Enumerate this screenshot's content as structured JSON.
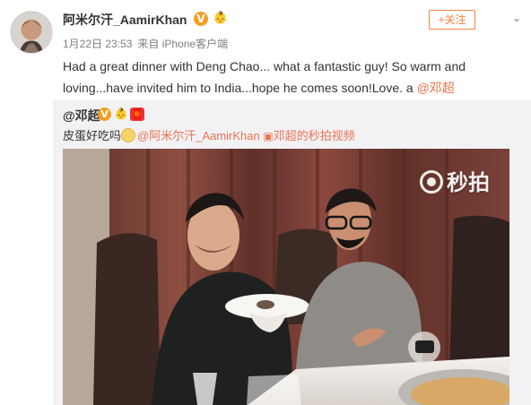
{
  "post": {
    "username": "阿米尔汗_AamirKhan",
    "verified_icon": "V",
    "level_icon": "👶",
    "follow_label": "+关注",
    "menu_icon": "chevron-down-icon",
    "date": "1月22日 23:53",
    "source": "来自 iPhone客户端",
    "text_main": "Had a great dinner with Deng Chao... what a fantastic guy! So warm and loving...have invited him to India...hope he comes soon!Love. a ",
    "text_mention": "@邓超"
  },
  "repost": {
    "username": "@邓超",
    "verified_icon": "V",
    "badge_1": "👶",
    "badge_2": "🧧",
    "text": "皮蛋好吃吗",
    "mention": "@阿米尔汗_AamirKhan",
    "video_link": "邓超的秒拍视频",
    "video_watermark": "秒拍"
  },
  "colors": {
    "accent": "#eb7350",
    "follow": "#ff8140",
    "repost_bg": "#f2f2f5"
  }
}
